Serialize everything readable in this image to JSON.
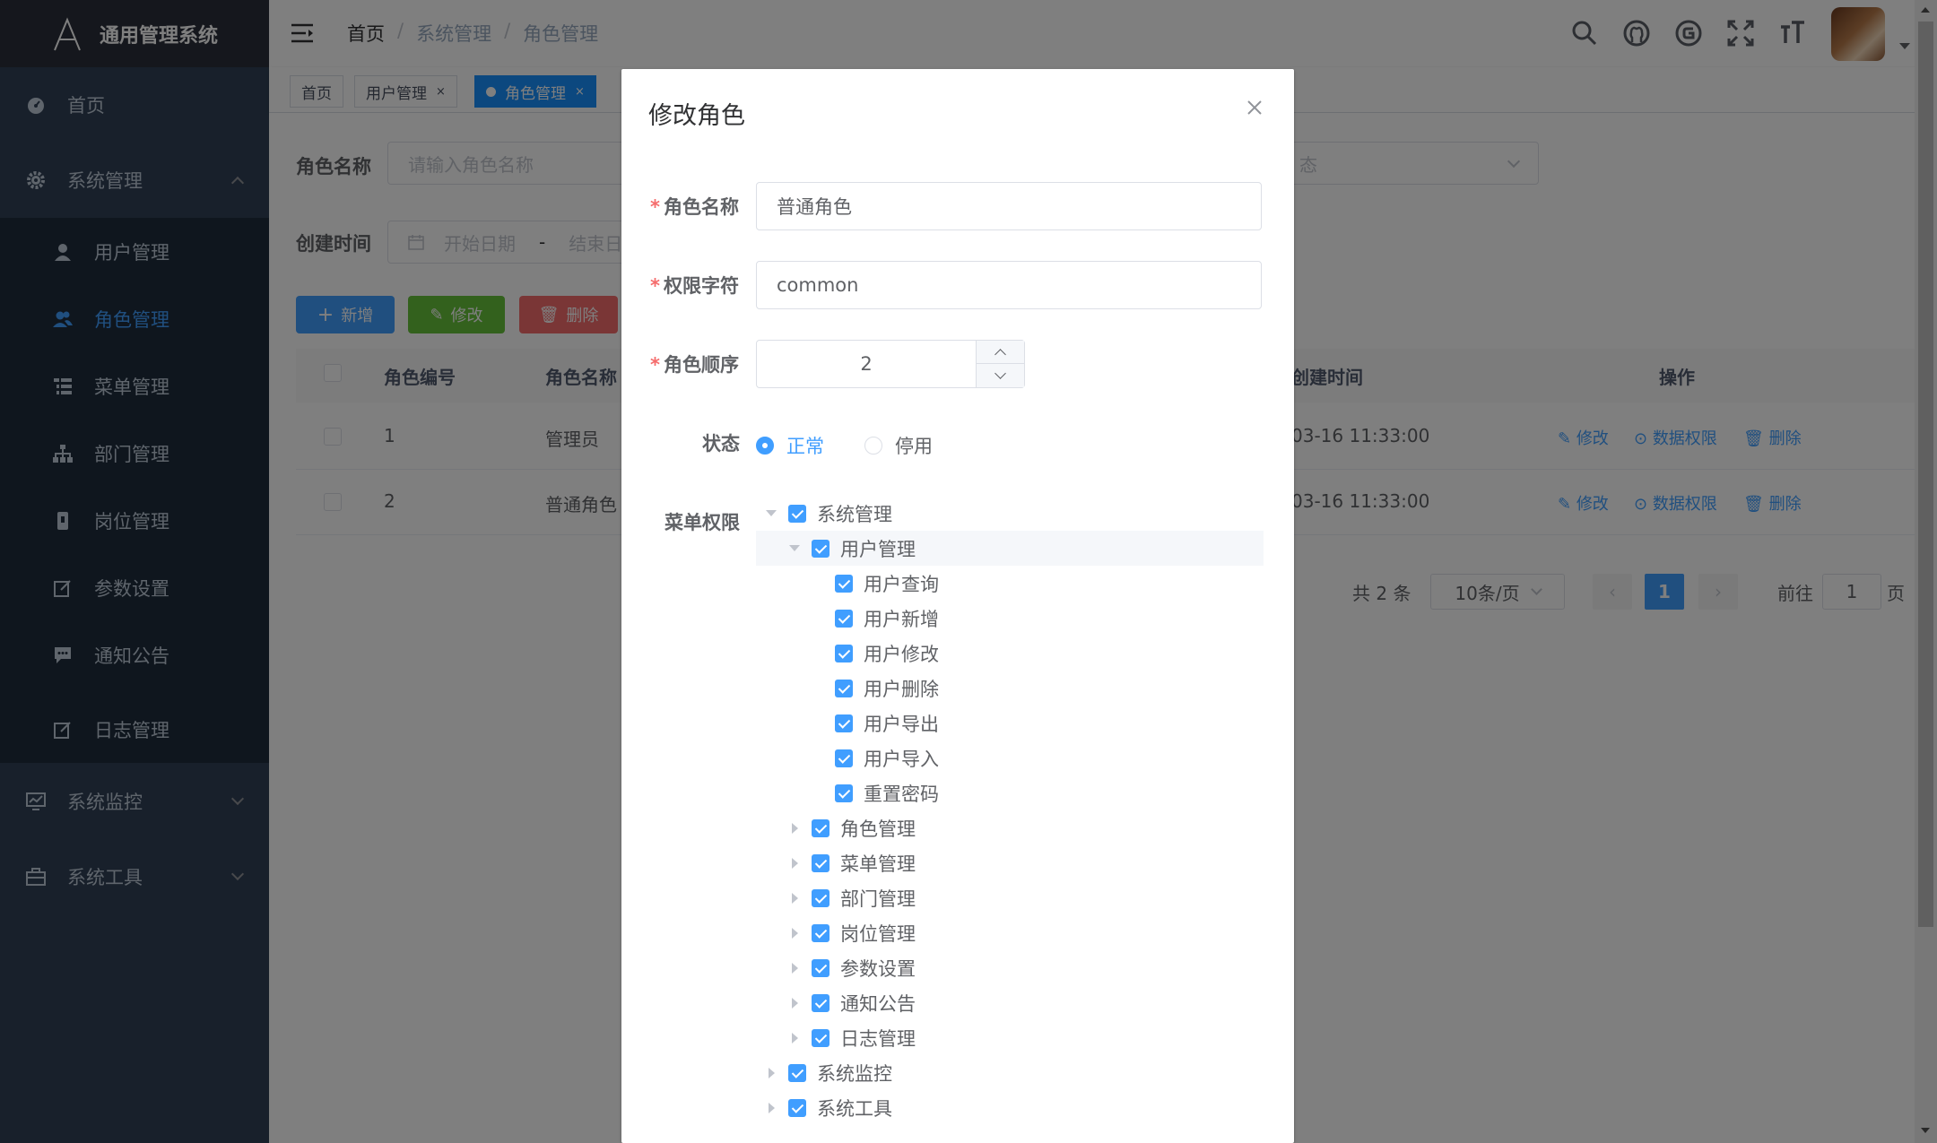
{
  "app": {
    "title": "通用管理系统"
  },
  "sidebar": {
    "home": "首页",
    "system": "系统管理",
    "sub": [
      "用户管理",
      "角色管理",
      "菜单管理",
      "部门管理",
      "岗位管理",
      "参数设置",
      "通知公告",
      "日志管理"
    ],
    "monitor": "系统监控",
    "tools": "系统工具"
  },
  "breadcrumb": {
    "home": "首页",
    "sep": "/",
    "level1": "系统管理",
    "level2": "角色管理"
  },
  "tags": {
    "home": "首页",
    "user": "用户管理",
    "role": "角色管理",
    "close": "×"
  },
  "search": {
    "role_name_label": "角色名称",
    "role_name_placeholder": "请输入角色名称",
    "status_placeholder": "态",
    "created_label": "创建时间",
    "start_date": "开始日期",
    "dash": "-",
    "end_date": "结束日"
  },
  "toolbar": {
    "add": "新增",
    "edit": "修改",
    "delete": "删除"
  },
  "table": {
    "headers": {
      "id": "角色编号",
      "name": "角色名称",
      "created": "创建时间",
      "ops": "操作"
    },
    "rows": [
      {
        "id": "1",
        "name": "管理员",
        "created": "03-16 11:33:00"
      },
      {
        "id": "2",
        "name": "普通角色",
        "created": "03-16 11:33:00"
      }
    ],
    "ops": {
      "edit": "修改",
      "data_scope": "数据权限",
      "delete": "删除"
    }
  },
  "pager": {
    "total": "共 2 条",
    "size": "10条/页",
    "current": "1",
    "goto": "前往",
    "goto_value": "1",
    "page_unit": "页"
  },
  "dialog": {
    "title": "修改角色",
    "role_name_label": "角色名称",
    "role_name_value": "普通角色",
    "role_key_label": "权限字符",
    "role_key_value": "common",
    "sort_label": "角色顺序",
    "sort_value": "2",
    "status_label": "状态",
    "status_normal": "正常",
    "status_disabled": "停用",
    "menu_label": "菜单权限",
    "required_mark": "*",
    "tree": [
      "系统管理",
      "用户管理",
      "用户查询",
      "用户新增",
      "用户修改",
      "用户删除",
      "用户导出",
      "用户导入",
      "重置密码",
      "角色管理",
      "菜单管理",
      "部门管理",
      "岗位管理",
      "参数设置",
      "通知公告",
      "日志管理",
      "系统监控",
      "系统工具"
    ]
  },
  "colors": {
    "primary": "#409eff",
    "sidebar_bg": "#304156",
    "success": "#67c23a",
    "danger": "#f56c6c"
  }
}
